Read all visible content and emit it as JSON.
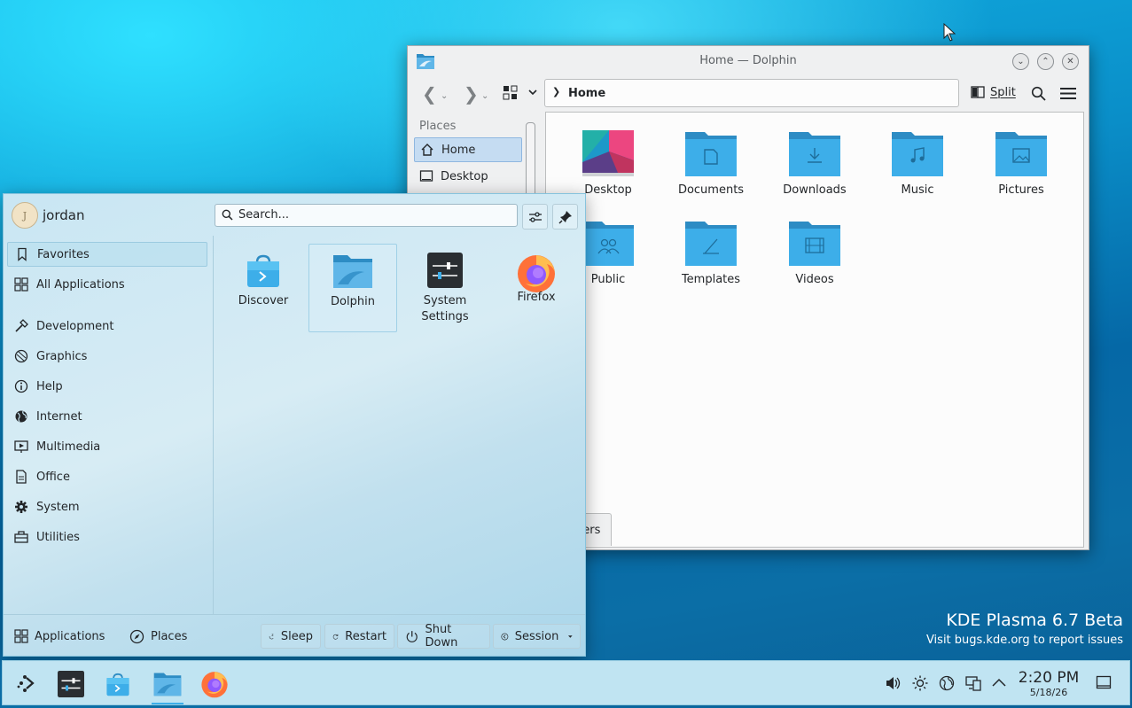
{
  "wallpaper": {
    "line1": "KDE Plasma 6.7 Beta",
    "line2": "Visit bugs.kde.org to report issues"
  },
  "dolphin": {
    "title": "Home — Dolphin",
    "breadcrumb": "Home",
    "split_label": "Split",
    "places_header": "Places",
    "places": [
      {
        "label": "Home"
      },
      {
        "label": "Desktop"
      }
    ],
    "files": [
      {
        "label": "Desktop"
      },
      {
        "label": "Documents"
      },
      {
        "label": "Downloads"
      },
      {
        "label": "Music"
      },
      {
        "label": "Pictures"
      },
      {
        "label": "Public"
      },
      {
        "label": "Templates"
      },
      {
        "label": "Videos"
      }
    ],
    "tab_fragment": "ders"
  },
  "kickoff": {
    "username": "jordan",
    "avatar_letter": "J",
    "search_placeholder": "Search...",
    "categories": [
      {
        "label": "Favorites"
      },
      {
        "label": "All Applications"
      },
      {
        "label": "Development"
      },
      {
        "label": "Graphics"
      },
      {
        "label": "Help"
      },
      {
        "label": "Internet"
      },
      {
        "label": "Multimedia"
      },
      {
        "label": "Office"
      },
      {
        "label": "System"
      },
      {
        "label": "Utilities"
      }
    ],
    "apps": [
      {
        "label": "Discover"
      },
      {
        "label": "Dolphin"
      },
      {
        "label": "System Settings"
      },
      {
        "label": "Firefox"
      }
    ],
    "footer": {
      "applications": "Applications",
      "places": "Places",
      "sleep": "Sleep",
      "restart": "Restart",
      "shutdown": "Shut Down",
      "session": "Session"
    }
  },
  "panel": {
    "time": "2:20 PM",
    "date": "5/18/26"
  },
  "colors": {
    "accent": "#3daee9",
    "folder": "#3daee9",
    "folder_dark": "#2d8cc4"
  }
}
